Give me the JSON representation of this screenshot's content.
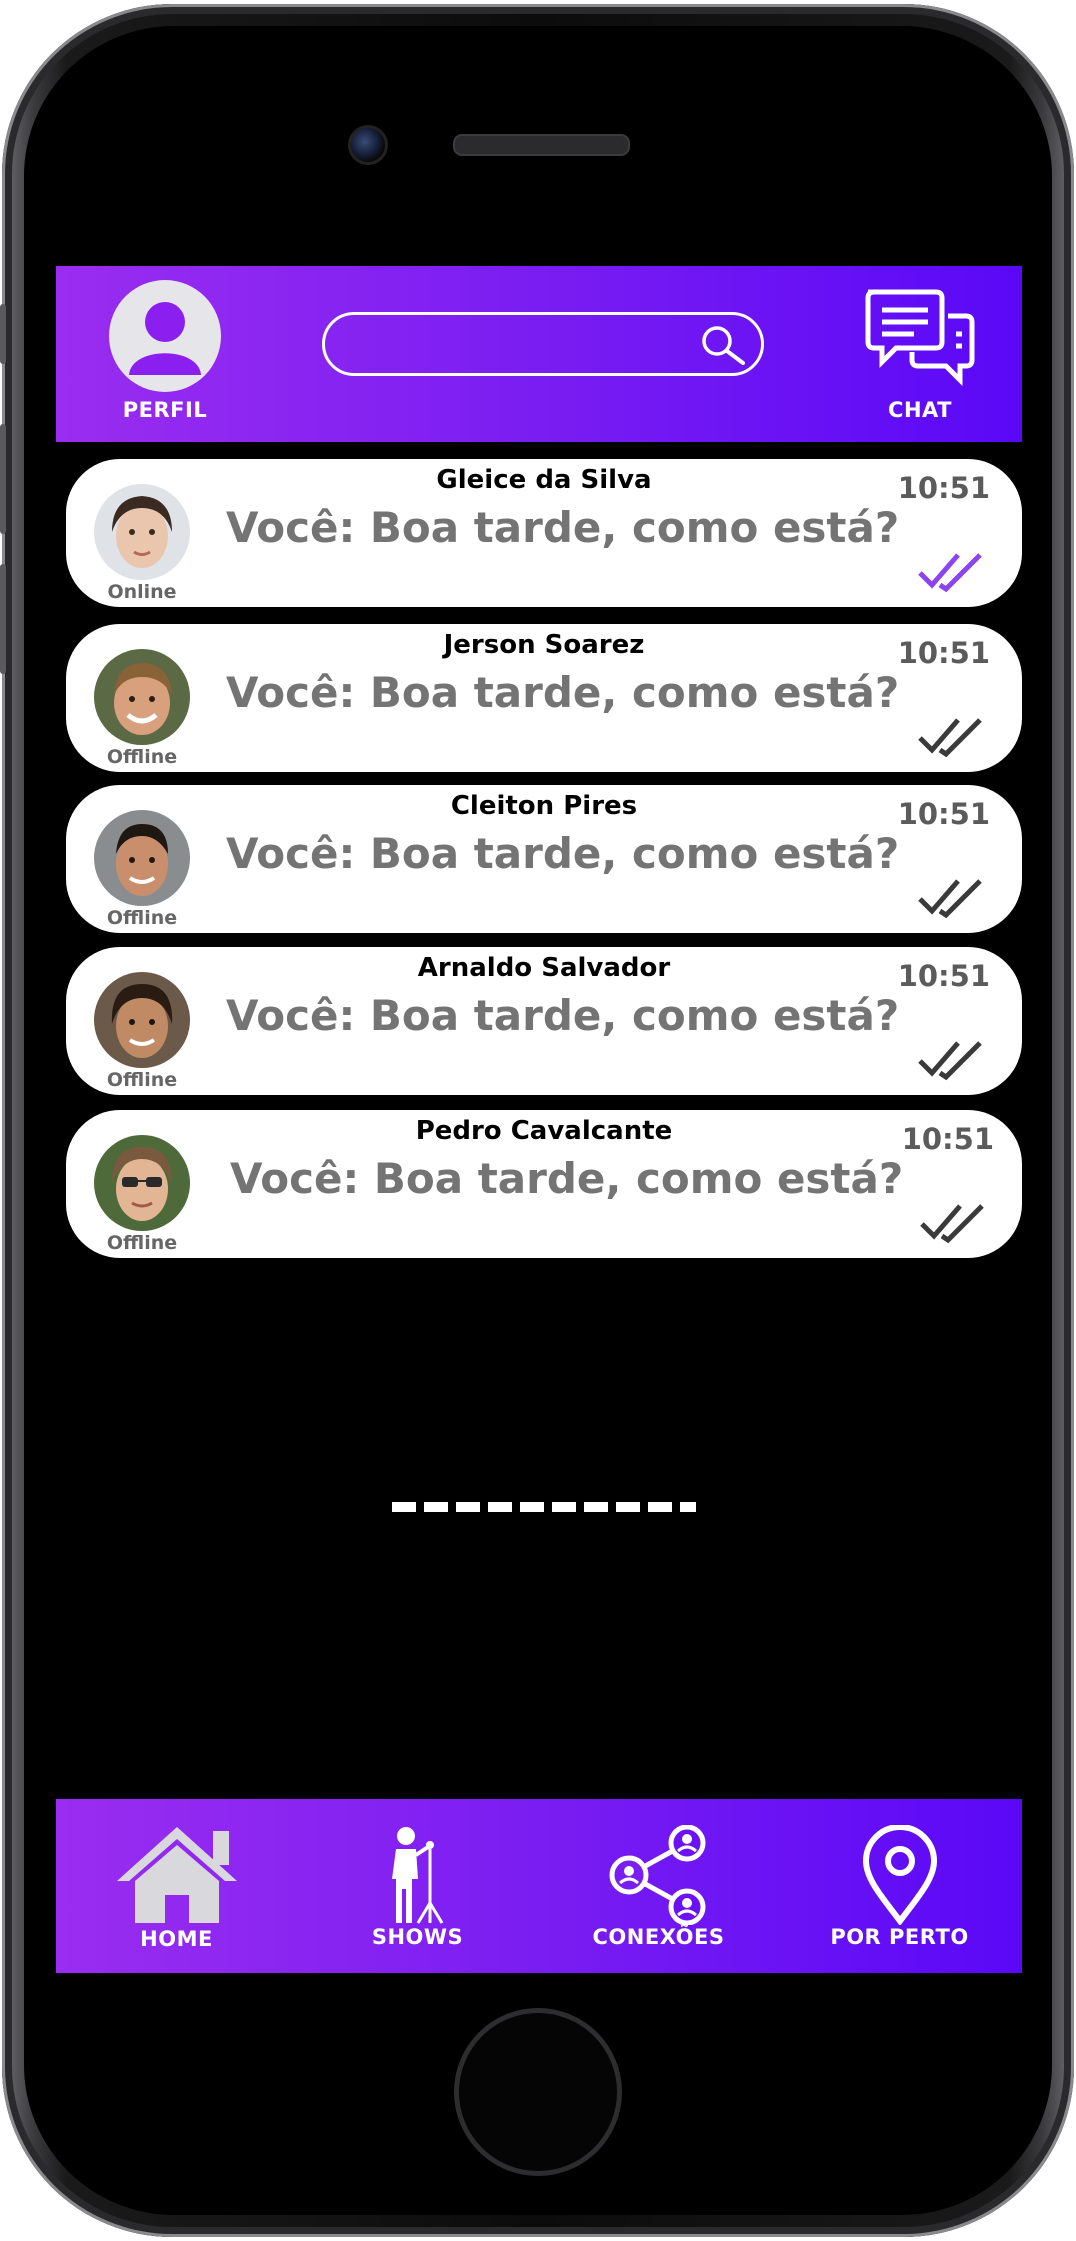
{
  "colors": {
    "accent_start": "#9a2df0",
    "accent_end": "#5a08f7",
    "read_check": "#8a44f0",
    "unread_check": "#3a3a3a"
  },
  "header": {
    "profile_label": "PERFIL",
    "chat_label": "CHAT",
    "search_icon": "search-icon",
    "chat_icon": "chat-bubbles-icon"
  },
  "chats": [
    {
      "name": "Gleice da Silva",
      "status": "Online",
      "message": "Você: Boa tarde, como está?",
      "time": "10:51",
      "read": true
    },
    {
      "name": "Jerson Soarez",
      "status": "Offline",
      "message": "Você: Boa tarde, como está?",
      "time": "10:51",
      "read": false
    },
    {
      "name": "Cleiton Pires",
      "status": "Offline",
      "message": "Você: Boa tarde, como está?",
      "time": "10:51",
      "read": false
    },
    {
      "name": "Arnaldo Salvador",
      "status": "Offline",
      "message": "Você: Boa tarde, como está?",
      "time": "10:51",
      "read": false
    },
    {
      "name": "Pedro Cavalcante",
      "status": "Offline",
      "message": "Você: Boa tarde, como está?",
      "time": "10:51",
      "read": false
    }
  ],
  "bottom_nav": [
    {
      "label": "HOME",
      "icon": "house-icon"
    },
    {
      "label": "SHOWS",
      "icon": "singer-microphone-icon"
    },
    {
      "label": "CONEXÕES",
      "icon": "share-network-icon"
    },
    {
      "label": "POR PERTO",
      "icon": "location-pin-icon"
    }
  ]
}
